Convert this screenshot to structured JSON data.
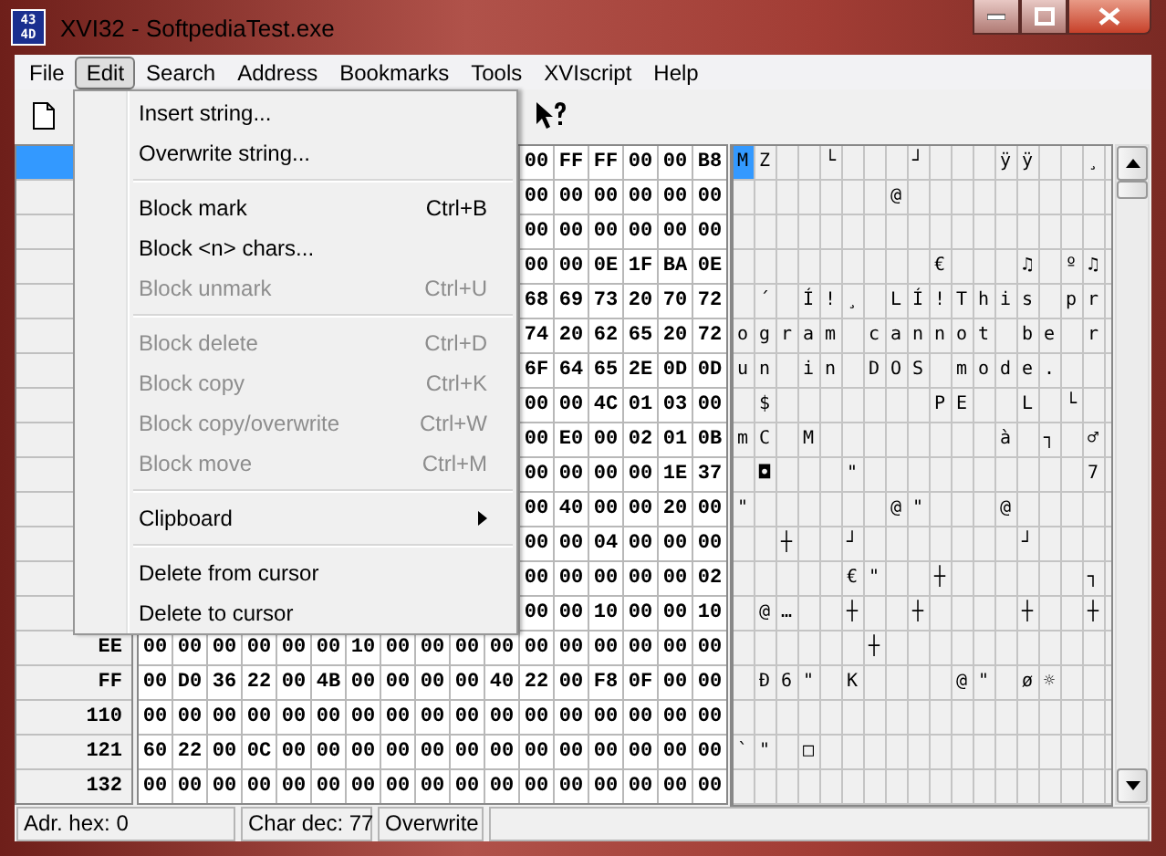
{
  "window": {
    "title": "XVI32 - SoftpediaTest.exe",
    "icon_text": [
      "43",
      "4D"
    ]
  },
  "menubar": [
    {
      "label": "File",
      "selected": false
    },
    {
      "label": "Edit",
      "selected": true
    },
    {
      "label": "Search",
      "selected": false
    },
    {
      "label": "Address",
      "selected": false
    },
    {
      "label": "Bookmarks",
      "selected": false
    },
    {
      "label": "Tools",
      "selected": false
    },
    {
      "label": "XVIscript",
      "selected": false
    },
    {
      "label": "Help",
      "selected": false
    }
  ],
  "edit_menu": [
    {
      "kind": "item",
      "label": "Insert string...",
      "disabled": false
    },
    {
      "kind": "item",
      "label": "Overwrite string...",
      "disabled": false
    },
    {
      "kind": "separator"
    },
    {
      "kind": "item",
      "label": "Block mark",
      "shortcut": "Ctrl+B",
      "disabled": false
    },
    {
      "kind": "item",
      "label": "Block <n> chars...",
      "disabled": false
    },
    {
      "kind": "item",
      "label": "Block unmark",
      "shortcut": "Ctrl+U",
      "disabled": true
    },
    {
      "kind": "separator"
    },
    {
      "kind": "item",
      "label": "Block delete",
      "shortcut": "Ctrl+D",
      "disabled": true
    },
    {
      "kind": "item",
      "label": "Block copy",
      "shortcut": "Ctrl+K",
      "disabled": true
    },
    {
      "kind": "item",
      "label": "Block copy/overwrite",
      "shortcut": "Ctrl+W",
      "disabled": true
    },
    {
      "kind": "item",
      "label": "Block move",
      "shortcut": "Ctrl+M",
      "disabled": true
    },
    {
      "kind": "separator"
    },
    {
      "kind": "submenu",
      "label": "Clipboard",
      "disabled": false
    },
    {
      "kind": "separator"
    },
    {
      "kind": "item",
      "label": "Delete from cursor",
      "disabled": false
    },
    {
      "kind": "item",
      "label": "Delete to cursor",
      "disabled": false
    }
  ],
  "rows": [
    {
      "selected": true,
      "hex": [
        "00",
        "FF",
        "FF",
        "00",
        "00",
        "B8"
      ],
      "text": "MZ  └   ┘   ÿÿ  ¸"
    },
    {
      "selected": false,
      "hex": [
        "00",
        "00",
        "00",
        "00",
        "00",
        "00"
      ],
      "text": "       @         "
    },
    {
      "selected": false,
      "hex": [
        "00",
        "00",
        "00",
        "00",
        "00",
        "00"
      ]
    },
    {
      "selected": false,
      "hex": [
        "00",
        "00",
        "0E",
        "1F",
        "BA",
        "0E"
      ],
      "text": "         €   ♫ º♫"
    },
    {
      "selected": false,
      "hex": [
        "68",
        "69",
        "73",
        "20",
        "70",
        "72"
      ],
      "text": " ´ Í!¸ LÍ!This pr"
    },
    {
      "selected": false,
      "hex": [
        "74",
        "20",
        "62",
        "65",
        "20",
        "72"
      ],
      "text": "ogram cannot be r"
    },
    {
      "selected": false,
      "hex": [
        "6F",
        "64",
        "65",
        "2E",
        "0D",
        "0D"
      ],
      "text": "un in DOS mode.  "
    },
    {
      "selected": false,
      "hex": [
        "00",
        "00",
        "4C",
        "01",
        "03",
        "00"
      ],
      "text": " $       PE  L └ "
    },
    {
      "selected": false,
      "hex": [
        "00",
        "E0",
        "00",
        "02",
        "01",
        "0B"
      ],
      "text": "mC M        à ┐ ♂"
    },
    {
      "selected": false,
      "hex": [
        "00",
        "00",
        "00",
        "00",
        "1E",
        "37"
      ],
      "text": " ◘   \"          7"
    },
    {
      "selected": false,
      "hex": [
        "00",
        "40",
        "00",
        "00",
        "20",
        "00"
      ],
      "text": "\"      @\"   @    "
    },
    {
      "selected": false,
      "hex": [
        "00",
        "00",
        "04",
        "00",
        "00",
        "00"
      ],
      "text": "  ┼  ┘       ┘   "
    },
    {
      "selected": false,
      "hex": [
        "00",
        "00",
        "00",
        "00",
        "00",
        "02"
      ],
      "text": "     €\"  ┼      ┐"
    },
    {
      "selected": false,
      "hex": [
        "00",
        "00",
        "10",
        "00",
        "00",
        "10"
      ],
      "text": " @…  ┼  ┼    ┼  ┼"
    },
    {
      "address": "EE",
      "selected": false,
      "hex": [
        "00",
        "00",
        "00",
        "00",
        "00",
        "00",
        "10",
        "00",
        "00",
        "00",
        "00",
        "00",
        "00",
        "00",
        "00",
        "00",
        "00"
      ],
      "text": "      ┼          "
    },
    {
      "address": "FF",
      "selected": false,
      "hex": [
        "00",
        "D0",
        "36",
        "22",
        "00",
        "4B",
        "00",
        "00",
        "00",
        "00",
        "40",
        "22",
        "00",
        "F8",
        "0F",
        "00",
        "00"
      ],
      "text": " Ð6\" K    @\" ø☼  "
    },
    {
      "address": "110",
      "selected": false,
      "hex": [
        "00",
        "00",
        "00",
        "00",
        "00",
        "00",
        "00",
        "00",
        "00",
        "00",
        "00",
        "00",
        "00",
        "00",
        "00",
        "00",
        "00"
      ]
    },
    {
      "address": "121",
      "selected": false,
      "hex": [
        "60",
        "22",
        "00",
        "0C",
        "00",
        "00",
        "00",
        "00",
        "00",
        "00",
        "00",
        "00",
        "00",
        "00",
        "00",
        "00",
        "00"
      ],
      "text": "`\" □             "
    },
    {
      "address": "132",
      "selected": false,
      "hex": [
        "00",
        "00",
        "00",
        "00",
        "00",
        "00",
        "00",
        "00",
        "00",
        "00",
        "00",
        "00",
        "00",
        "00",
        "00",
        "00",
        "00"
      ]
    }
  ],
  "status_bar": [
    "Adr. hex: 0",
    "Char dec: 77",
    "Overwrite"
  ]
}
